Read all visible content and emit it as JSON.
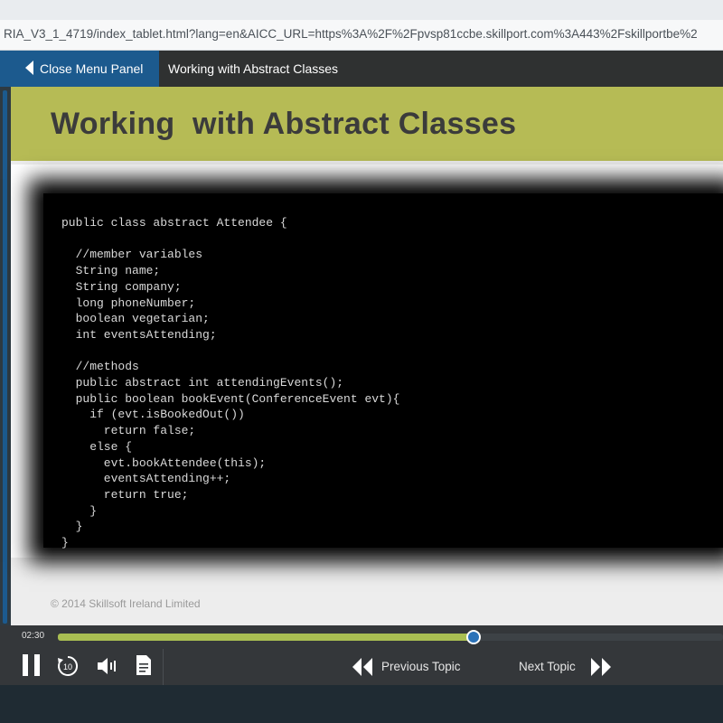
{
  "browser": {
    "url": "RIA_V3_1_4719/index_tablet.html?lang=en&AICC_URL=https%3A%2F%2Fpvsp81ccbe.skillport.com%3A443%2Fskillportbe%2"
  },
  "nav": {
    "close_label": "Close Menu Panel",
    "title": "Working with Abstract Classes"
  },
  "slide": {
    "title": "Working  with Abstract Classes",
    "code": "public class abstract Attendee {\n\n  //member variables\n  String name;\n  String company;\n  long phoneNumber;\n  boolean vegetarian;\n  int eventsAttending;\n\n  //methods\n  public abstract int attendingEvents();\n  public boolean bookEvent(ConferenceEvent evt){\n    if (evt.isBookedOut())\n      return false;\n    else {\n      evt.bookAttendee(this);\n      eventsAttending++;\n      return true;\n    }\n  }\n}",
    "copyright": "© 2014 Skillsoft Ireland Limited"
  },
  "player": {
    "time": "02:30",
    "progress_fraction": 0.625,
    "prev_label": "Previous Topic",
    "next_label": "Next Topic",
    "icons": [
      "pause-icon",
      "replay-10-icon",
      "volume-icon",
      "transcript-icon",
      "double-chevron-left-icon",
      "double-chevron-right-icon"
    ]
  },
  "colors": {
    "accent_blue": "#1c5a8e",
    "title_band": "#b6bb55",
    "progress": "#a9be52"
  }
}
